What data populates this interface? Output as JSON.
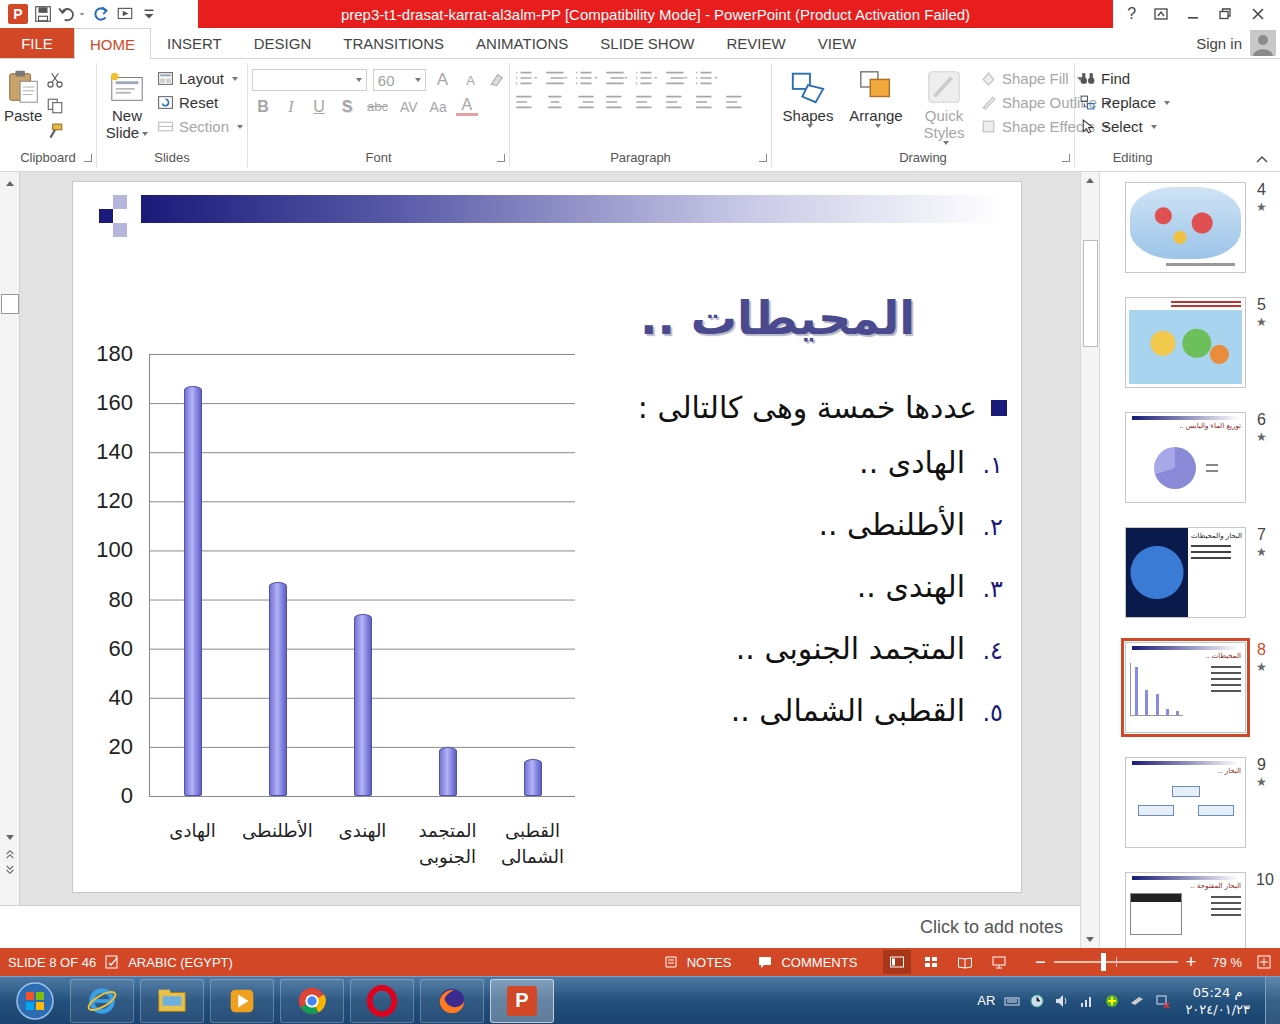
{
  "window": {
    "title": "prep3-t1-drasat-karrat-al3alm-PP [Compatibility Mode] -  PowerPoint (Product Activation Failed)",
    "app_letter": "P",
    "help": "?"
  },
  "tabs": [
    {
      "label": "FILE",
      "kind": "file",
      "selected": false
    },
    {
      "label": "HOME",
      "kind": "tab",
      "selected": true
    },
    {
      "label": "INSERT",
      "kind": "tab",
      "selected": false
    },
    {
      "label": "DESIGN",
      "kind": "tab",
      "selected": false
    },
    {
      "label": "TRANSITIONS",
      "kind": "tab",
      "selected": false
    },
    {
      "label": "ANIMATIONS",
      "kind": "tab",
      "selected": false
    },
    {
      "label": "SLIDE SHOW",
      "kind": "tab",
      "selected": false
    },
    {
      "label": "REVIEW",
      "kind": "tab",
      "selected": false
    },
    {
      "label": "VIEW",
      "kind": "tab",
      "selected": false
    }
  ],
  "account": {
    "label": "Sign in"
  },
  "ribbon": {
    "clipboard": {
      "label": "Clipboard",
      "paste": "Paste"
    },
    "slides": {
      "label": "Slides",
      "new_slide": "New Slide",
      "commands": [
        {
          "label": "Layout",
          "kind": "layout",
          "dropdown": true,
          "disabled": false
        },
        {
          "label": "Reset",
          "kind": "reset",
          "dropdown": false,
          "disabled": false
        },
        {
          "label": "Section",
          "kind": "section",
          "dropdown": true,
          "disabled": true
        }
      ]
    },
    "font": {
      "label": "Font",
      "name": "",
      "size": "60",
      "disabled": true,
      "grow": "A",
      "shrink": "A",
      "format_buttons": [
        {
          "label": "B",
          "kind": "bold"
        },
        {
          "label": "I",
          "kind": "italic"
        },
        {
          "label": "U",
          "kind": "underline"
        },
        {
          "label": "S",
          "kind": "shadow"
        },
        {
          "label": "abc",
          "kind": "strike"
        },
        {
          "label": "AV",
          "kind": "spacing"
        },
        {
          "label": "Aa",
          "kind": "case"
        },
        {
          "label": "A",
          "kind": "color"
        }
      ]
    },
    "paragraph": {
      "label": "Paragraph",
      "disabled": true
    },
    "drawing": {
      "label": "Drawing",
      "large": [
        {
          "label": "Shapes",
          "kind": "shapes",
          "disabled": false
        },
        {
          "label": "Arrange",
          "kind": "arrange",
          "disabled": false
        },
        {
          "label": "Quick Styles",
          "kind": "styles",
          "disabled": true
        }
      ],
      "small": [
        {
          "label": "Shape Fill",
          "kind": "fill",
          "disabled": true
        },
        {
          "label": "Shape Outline",
          "kind": "outline",
          "disabled": true
        },
        {
          "label": "Shape Effects",
          "kind": "effects",
          "disabled": true
        }
      ]
    },
    "editing": {
      "label": "Editing",
      "commands": [
        {
          "label": "Find",
          "kind": "find",
          "dropdown": false
        },
        {
          "label": "Replace",
          "kind": "replace",
          "dropdown": true
        },
        {
          "label": "Select",
          "kind": "select",
          "dropdown": true
        }
      ]
    }
  },
  "slide": {
    "title": "المحيطات ..",
    "bullet": "عددها خمسة وهى كالتالى :",
    "items": [
      {
        "number": "١.",
        "text": "الهادى .."
      },
      {
        "number": "٢.",
        "text": "الأطلنطى .."
      },
      {
        "number": "٣.",
        "text": "الهندى .."
      },
      {
        "number": "٤.",
        "text": "المتجمد الجنوبى .."
      },
      {
        "number": "٥.",
        "text": "القطبى الشمالى .."
      }
    ],
    "chart": {
      "y_max": 180,
      "y_ticks": [
        "180",
        "160",
        "140",
        "120",
        "100",
        "80",
        "60",
        "40",
        "20",
        "0"
      ],
      "categories": [
        "الهادى",
        "الأطلنطى",
        "الهندى",
        "المتجمد الجنوبى",
        "القطبى الشمالى"
      ],
      "series": [
        {
          "values": [
            167,
            87,
            74,
            20,
            15
          ]
        }
      ]
    }
  },
  "notes": {
    "placeholder": "Click to add notes"
  },
  "thumbnails": [
    {
      "number": "4",
      "star": "★",
      "selected": false,
      "kind": "world-map"
    },
    {
      "number": "5",
      "star": "★",
      "selected": false,
      "kind": "map-text"
    },
    {
      "number": "6",
      "star": "★",
      "selected": false,
      "kind": "pie",
      "title": "توزيع الماء واليابس .."
    },
    {
      "number": "7",
      "star": "★",
      "selected": false,
      "kind": "globe",
      "title": "البحار والمحيطات"
    },
    {
      "number": "8",
      "star": "★",
      "selected": true,
      "kind": "chart",
      "title": "المحيطات .."
    },
    {
      "number": "9",
      "star": "★",
      "selected": false,
      "kind": "diagram",
      "title": "البحار .."
    },
    {
      "number": "10",
      "selected": false,
      "kind": "text",
      "title": "البحار المفتوحة .."
    }
  ],
  "status_bar": {
    "slide_info": "SLIDE 8 OF 46",
    "language": "ARABIC (EGYPT)",
    "notes": "NOTES",
    "comments": "COMMENTS",
    "views": [
      {
        "kind": "normal",
        "selected": true
      },
      {
        "kind": "sorter",
        "selected": false
      },
      {
        "kind": "reading",
        "selected": false
      },
      {
        "kind": "slideshow",
        "selected": false
      }
    ],
    "zoom_out": "−",
    "zoom_in": "+",
    "zoom": {
      "level": 0.4,
      "reading": "79 %"
    }
  },
  "taskbar": {
    "apps": [
      {
        "kind": "ie",
        "active": false
      },
      {
        "kind": "explorer",
        "active": false
      },
      {
        "kind": "media",
        "active": false
      },
      {
        "kind": "chrome",
        "active": false
      },
      {
        "kind": "opera",
        "active": false
      },
      {
        "kind": "firefox",
        "active": false
      },
      {
        "kind": "powerpoint",
        "active": true,
        "letter": "P"
      }
    ],
    "language": "AR",
    "time": "05:24 م",
    "date": "٢٠٢٤/٠١/٢٣"
  }
}
